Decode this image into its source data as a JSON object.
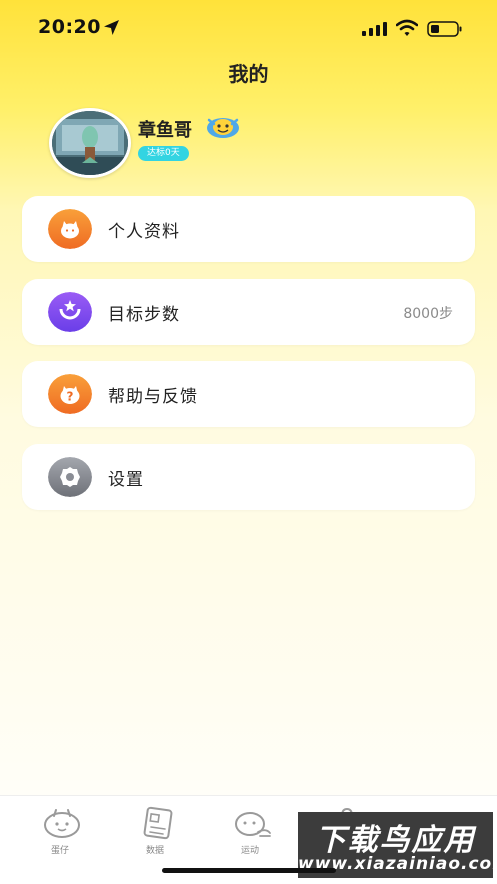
{
  "status_bar": {
    "time": "20:20"
  },
  "header": {
    "title": "我的"
  },
  "profile": {
    "username": "章鱼哥",
    "badge": "达标0天"
  },
  "menu": [
    {
      "label": "个人资料",
      "value": "",
      "icon": "pet-face-icon",
      "color": "#f07a2a"
    },
    {
      "label": "目标步数",
      "value": "8000步",
      "icon": "target-steps-icon",
      "color": "#7b4cf0"
    },
    {
      "label": "帮助与反馈",
      "value": "",
      "icon": "help-icon",
      "color": "#f07a2a"
    },
    {
      "label": "设置",
      "value": "",
      "icon": "settings-gear-icon",
      "color": "#8a8d95"
    }
  ],
  "tabs": [
    {
      "label": "蛋仔",
      "icon": "egg-pet-icon"
    },
    {
      "label": "数据",
      "icon": "data-report-icon"
    },
    {
      "label": "运动",
      "icon": "exercise-icon"
    },
    {
      "label": "",
      "icon": "shop-icon"
    },
    {
      "label": "",
      "icon": "profile-icon"
    }
  ],
  "watermark": {
    "top": "下载鸟应用",
    "bottom": "www.xiazainiao.com"
  },
  "colors": {
    "accent_yellow": "#ffe23a",
    "badge_cyan": "#33d4e2"
  }
}
